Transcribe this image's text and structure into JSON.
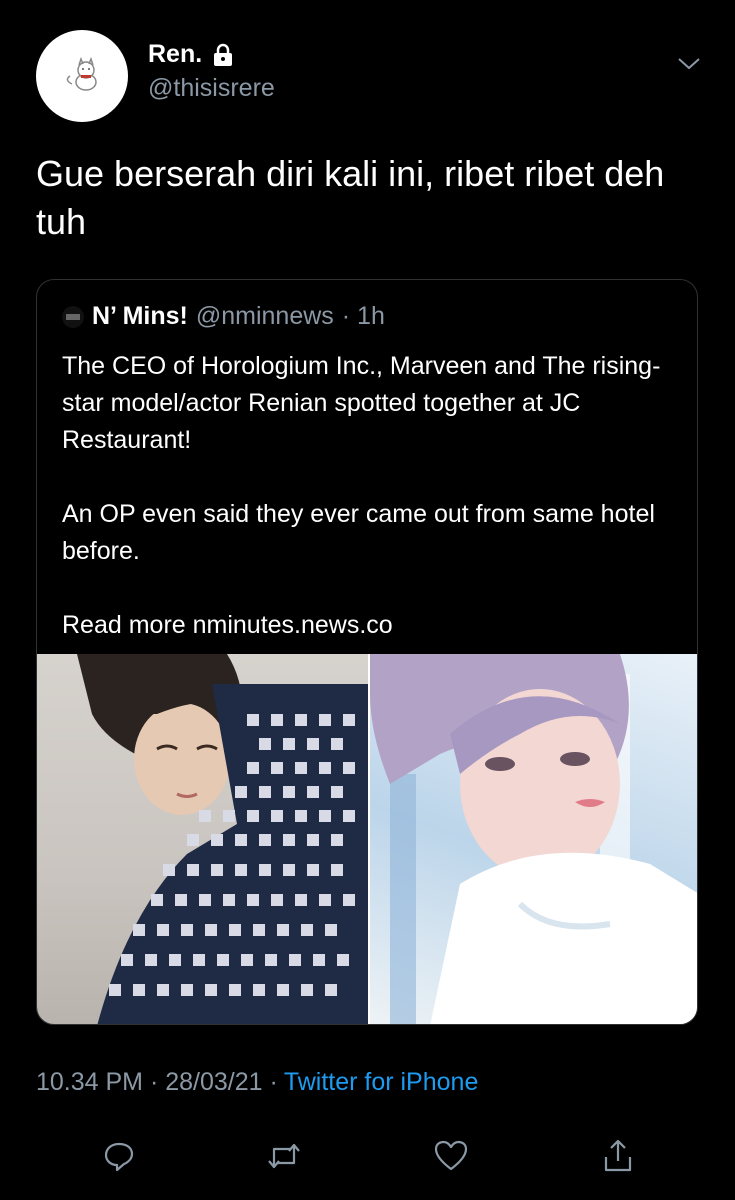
{
  "tweet": {
    "author_name": "Ren.",
    "author_handle": "@thisisrere",
    "text": "Gue berserah diri kali ini, ribet ribet deh tuh",
    "timestamp": "10.34 PM · 28/03/21 ·",
    "source": "Twitter for iPhone"
  },
  "quoted_tweet": {
    "name": "N’ Mins!",
    "handle": "@nminnews",
    "time": "· 1h",
    "text": "The CEO of Horologium Inc., Marveen and The rising-star model/actor Renian spotted together at JC Restaurant!\n\nAn OP even said they ever came out from same hotel before.\n\nRead more nminutes.news.co"
  },
  "icons": {
    "lock": "lock-icon",
    "chevron": "chevron-down-icon",
    "reply": "reply-icon",
    "retweet": "retweet-icon",
    "like": "like-icon",
    "share": "share-icon"
  },
  "colors": {
    "background": "#000000",
    "secondary_text": "#8b98a5",
    "link": "#1d9bf0"
  }
}
